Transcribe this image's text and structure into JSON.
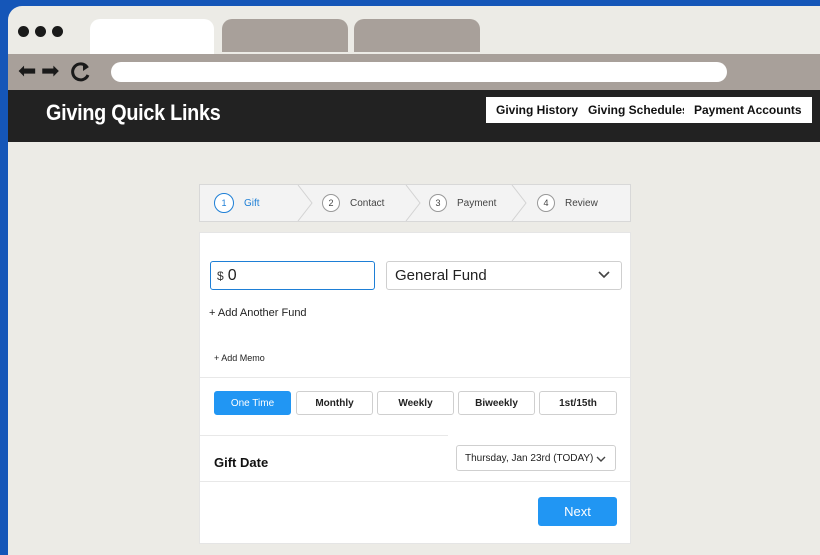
{
  "browser": {
    "tabs": [
      {
        "label": ""
      },
      {
        "label": ""
      },
      {
        "label": ""
      }
    ],
    "address": ""
  },
  "header": {
    "title": "Giving Quick Links",
    "buttons": [
      "Giving History",
      "Giving Schedules",
      "Payment Accounts"
    ]
  },
  "steps": [
    {
      "num": "1",
      "label": "Gift"
    },
    {
      "num": "2",
      "label": "Contact"
    },
    {
      "num": "3",
      "label": "Payment"
    },
    {
      "num": "4",
      "label": "Review"
    }
  ],
  "gift": {
    "currency": "$",
    "amount": "0",
    "fund": "General Fund",
    "add_fund": "+ Add Another Fund",
    "add_memo": "+ Add Memo"
  },
  "frequency": {
    "options": [
      "One Time",
      "Monthly",
      "Weekly",
      "Biweekly",
      "1st/15th"
    ],
    "selected": "One Time"
  },
  "gift_date": {
    "label": "Gift Date",
    "value": "Thursday, Jan 23rd (TODAY)"
  },
  "actions": {
    "next": "Next"
  },
  "colors": {
    "background": "#1556b8",
    "accent": "#2196f3",
    "header": "#222222"
  }
}
